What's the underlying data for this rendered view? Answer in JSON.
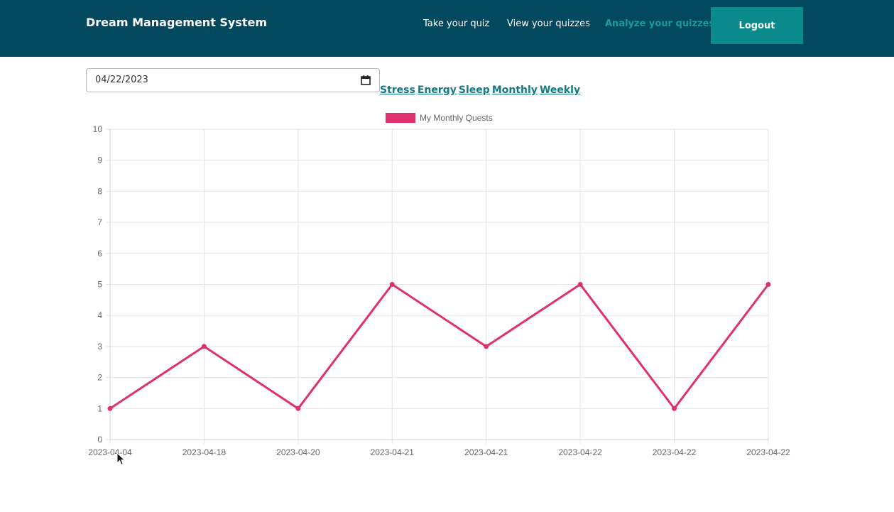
{
  "header": {
    "brand": "Dream Management System",
    "nav": {
      "take_quiz": "Take your quiz",
      "view_quizzes": "View your quizzes",
      "analyze_quizzes": "Analyze your quizzes"
    },
    "logout": "Logout"
  },
  "filter": {
    "date_value": "04/22/2023"
  },
  "tabs": [
    {
      "label": "Stress"
    },
    {
      "label": "Energy"
    },
    {
      "label": "Sleep"
    },
    {
      "label": "Monthly"
    },
    {
      "label": "Weekly"
    }
  ],
  "colors": {
    "navbar": "#02495f",
    "active_nav": "#1a9a9a",
    "logout": "#0b8a8c",
    "series": "#e0306e",
    "tab_link": "#137a82"
  },
  "chart_data": {
    "type": "line",
    "title": "",
    "xlabel": "",
    "ylabel": "",
    "ylim": [
      0,
      10
    ],
    "yticks": [
      0,
      1,
      2,
      3,
      4,
      5,
      6,
      7,
      8,
      9,
      10
    ],
    "grid": true,
    "legend_position": "top",
    "categories": [
      "2023-04-04",
      "2023-04-18",
      "2023-04-20",
      "2023-04-21",
      "2023-04-21",
      "2023-04-22",
      "2023-04-22",
      "2023-04-22"
    ],
    "series": [
      {
        "name": "My Monthly Quests",
        "values": [
          1,
          3,
          1,
          5,
          3,
          5,
          1,
          5
        ],
        "color": "#e0306e"
      }
    ]
  }
}
